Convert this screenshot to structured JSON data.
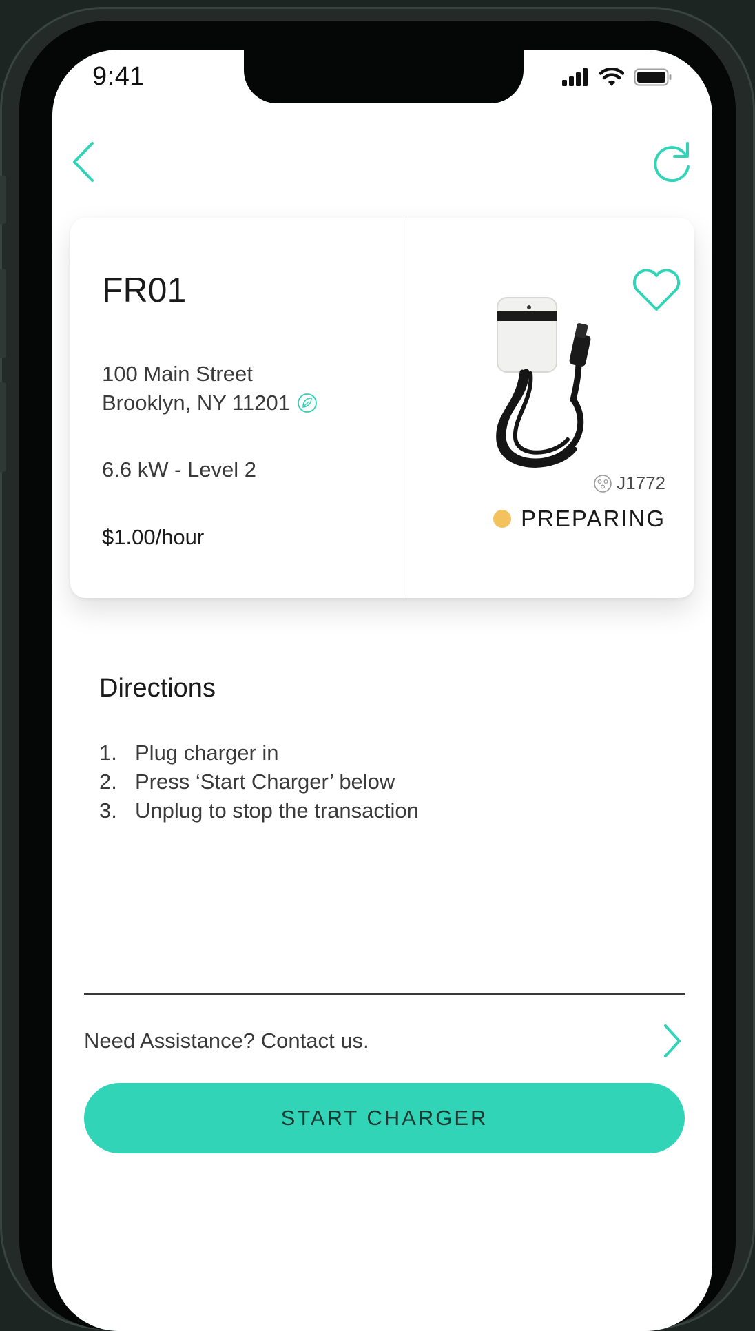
{
  "status_bar": {
    "time": "9:41",
    "icons": [
      "cellular-signal-icon",
      "wifi-icon",
      "battery-icon"
    ]
  },
  "nav": {
    "back_icon": "chevron-left-icon",
    "refresh_icon": "refresh-icon"
  },
  "station": {
    "id": "FR01",
    "address_line1": "100 Main Street",
    "address_line2": "Brooklyn, NY 11201",
    "address_icon": "leaf-icon",
    "power": "6.6 kW - Level 2",
    "price": "$1.00/hour",
    "favorite_icon": "heart-icon",
    "connector_type": "J1772",
    "status": "PREPARING",
    "status_color": "#f3c15d"
  },
  "directions": {
    "title": "Directions",
    "steps": [
      {
        "num": "1.",
        "text": "Plug charger in"
      },
      {
        "num": "2.",
        "text": "Press ‘Start Charger’ below"
      },
      {
        "num": "3.",
        "text": "Unplug to stop the transaction"
      }
    ]
  },
  "assistance": {
    "text": "Need Assistance? Contact us.",
    "icon": "chevron-right-icon"
  },
  "cta": {
    "label": "START CHARGER"
  },
  "colors": {
    "accent": "#32d4b7",
    "status_preparing": "#f3c15d",
    "background": "#ffffff"
  }
}
